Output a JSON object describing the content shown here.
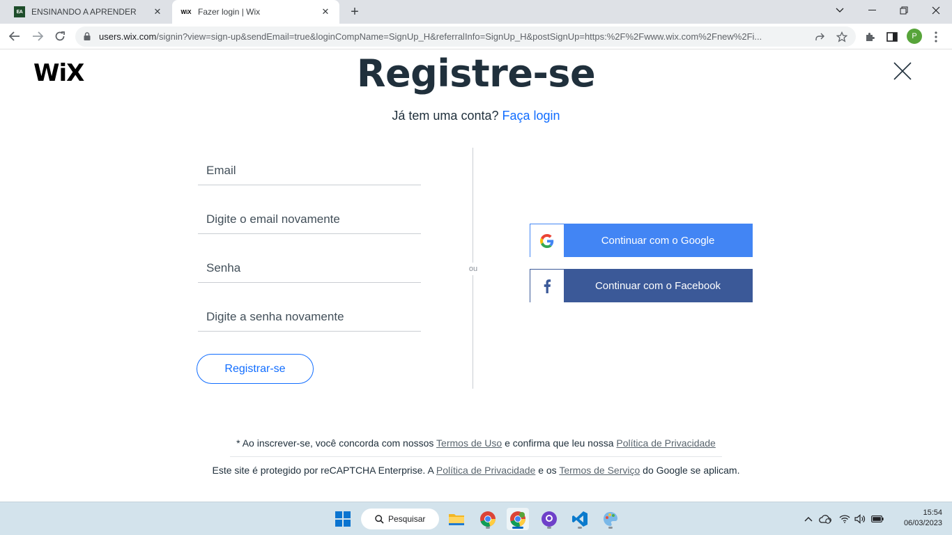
{
  "browser": {
    "tabs": [
      {
        "title": "ENSINANDO A APRENDER",
        "favicon": "ea-favicon-icon"
      },
      {
        "title": "Fazer login | Wix",
        "favicon": "wix-favicon-icon"
      }
    ],
    "url_host": "users.wix.com",
    "url_rest": "/signin?view=sign-up&sendEmail=true&loginCompName=SignUp_H&referralInfo=SignUp_H&postSignUp=https:%2F%2Fwww.wix.com%2Fnew%2Fi...",
    "profile_initial": "P"
  },
  "page": {
    "logo": "WiX",
    "title": "Registre-se",
    "subtitle_text": "Já tem uma conta?",
    "login_link": "Faça login",
    "fields": {
      "email": "Email",
      "email_confirm": "Digite o email novamente",
      "password": "Senha",
      "password_confirm": "Digite a senha novamente"
    },
    "register_button": "Registrar-se",
    "divider_text": "ou",
    "google_button": "Continuar com o Google",
    "facebook_button": "Continuar com o Facebook",
    "terms": {
      "prefix": "* Ao inscrever-se, você concorda com nossos",
      "terms_link": "Termos de Uso",
      "middle": "e confirma que leu nossa",
      "privacy_link": "Política de Privacidade"
    },
    "recaptcha": {
      "prefix": "Este site é protegido por reCAPTCHA Enterprise. A",
      "privacy_link": "Política de Privacidade",
      "middle": "e os",
      "terms_link": "Termos de Serviço",
      "suffix": "do Google se aplicam."
    },
    "colors": {
      "title": "#20303c",
      "link": "#116dff",
      "google": "#4285f4",
      "facebook": "#3b5998"
    }
  },
  "taskbar": {
    "search_label": "Pesquisar",
    "time": "15:54",
    "date": "06/03/2023"
  }
}
